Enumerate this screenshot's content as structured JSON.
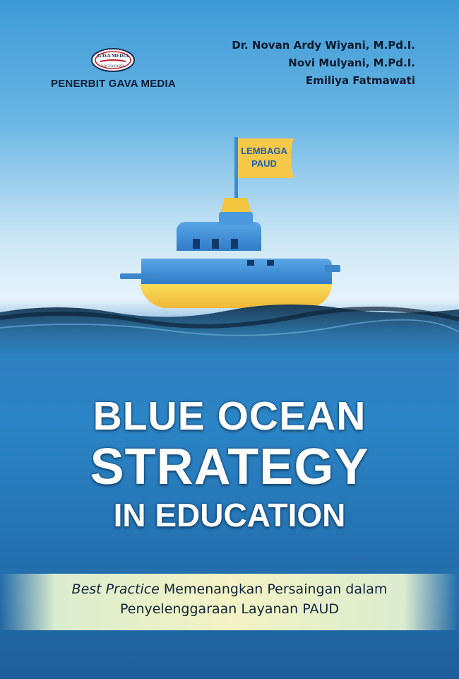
{
  "publisher": {
    "logo_text_top": "GAVA MEDIA",
    "logo_text_bottom": "YOGYAKARTA",
    "name": "PENERBIT GAVA MEDIA"
  },
  "authors": [
    "Dr. Novan Ardy Wiyani, M.Pd.I.",
    "Novi Mulyani, M.Pd.I.",
    "Emiliya Fatmawati"
  ],
  "flag": {
    "line1": "LEMBAGA",
    "line2": "PAUD"
  },
  "title": {
    "line1": "BLUE OCEAN",
    "line2": "STRATEGY",
    "line3": "IN EDUCATION"
  },
  "subtitle": {
    "italic": "Best Practice",
    "line1_rest": " Memenangkan Persaingan dalam",
    "line2": "Penyelenggaraan Layanan PAUD"
  },
  "colors": {
    "ocean_blue": "#2b85c6",
    "boat_blue": "#3f8fd8",
    "hull_yellow": "#f6d24c",
    "flag_yellow": "#f5c84a",
    "title_white": "#ffffff"
  }
}
